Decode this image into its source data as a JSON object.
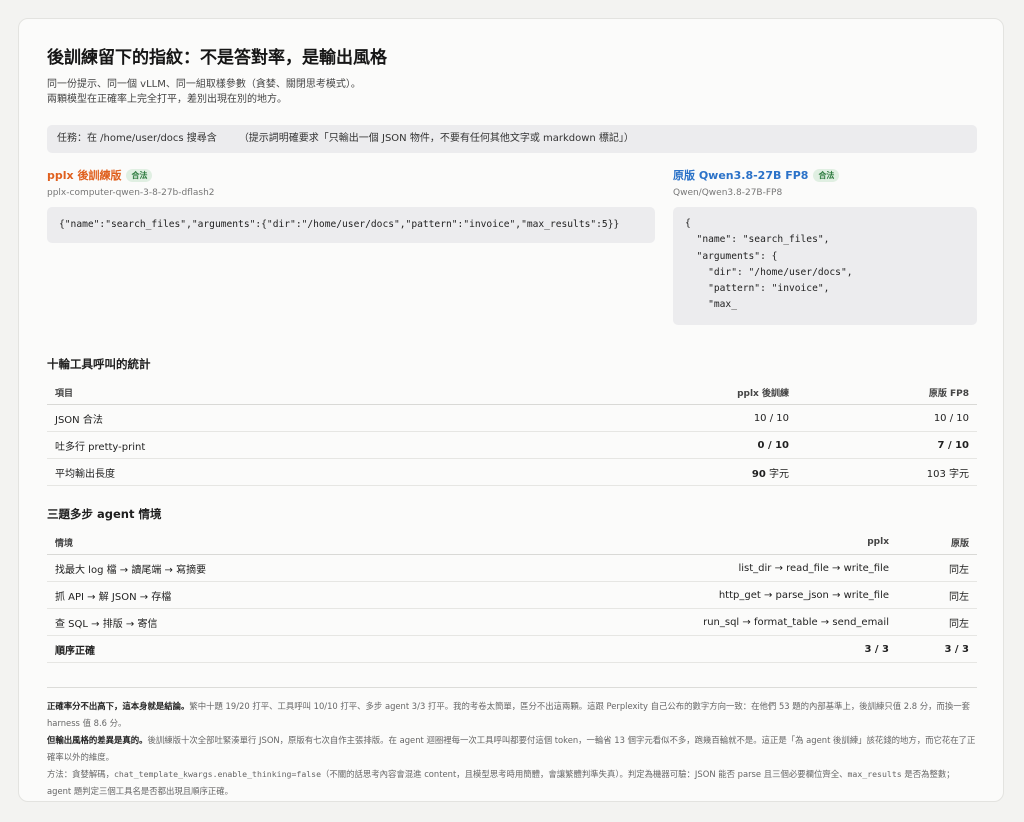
{
  "header": {
    "title": "後訓練留下的指紋：不是答對率，是輸出風格",
    "subtitle_1": "同一份提示、同一個 vLLM、同一組取樣參數（貪婪、關閉思考模式）。",
    "subtitle_2": "兩顆模型在正確率上完全打平，差別出現在別的地方。"
  },
  "task": {
    "label": "任務：在 /home/user/docs 搜尋含",
    "hint": "（提示詞明確要求「只輸出一個 JSON 物件，不要有任何其他文字或 markdown 標記」）"
  },
  "models": {
    "left": {
      "name": "pplx 後訓練版",
      "badge": "合法",
      "id": "pplx-computer-qwen-3-8-27b-dflash2",
      "code": "{\"name\":\"search_files\",\"arguments\":{\"dir\":\"/home/user/docs\",\"pattern\":\"invoice\",\"max_results\":5}}"
    },
    "right": {
      "name": "原版 Qwen3.8-27B FP8",
      "badge": "合法",
      "id": "Qwen/Qwen3.8-27B-FP8",
      "code": "{\n  \"name\": \"search_files\",\n  \"arguments\": {\n    \"dir\": \"/home/user/docs\",\n    \"pattern\": \"invoice\",\n    \"max_"
    }
  },
  "stats": {
    "title": "十輪工具呼叫的統計",
    "headers": [
      "項目",
      "pplx 後訓練",
      "原版 FP8"
    ],
    "rows": [
      {
        "item": "JSON 合法",
        "pplx": "10 / 10",
        "orig": "10 / 10"
      },
      {
        "item": "吐多行 pretty-print",
        "pplx": "0 / 10",
        "orig": "7 / 10"
      },
      {
        "item": "平均輸出長度",
        "pplx_num": "90",
        "pplx_unit": " 字元",
        "orig": "103 字元"
      }
    ]
  },
  "agent": {
    "title": "三題多步 agent 情境",
    "headers": [
      "情境",
      "pplx",
      "原版"
    ],
    "rows": [
      {
        "scenario": "找最大 log 檔 → 讀尾端 → 寫摘要",
        "pplx": "list_dir → read_file → write_file",
        "orig": "同左"
      },
      {
        "scenario": "抓 API → 解 JSON → 存檔",
        "pplx": "http_get → parse_json → write_file",
        "orig": "同左"
      },
      {
        "scenario": "查 SQL → 排版 → 寄信",
        "pplx": "run_sql → format_table → send_email",
        "orig": "同左"
      }
    ],
    "total": {
      "label": "順序正確",
      "pplx": "3 / 3",
      "orig": "3 / 3"
    }
  },
  "footer": {
    "p1_strong": "正確率分不出高下，這本身就是結論。",
    "p1": "繁中十題 19/20 打平、工具呼叫 10/10 打平、多步 agent 3/3 打平。我的考卷太簡單，區分不出這兩顆。這跟 Perplexity 自己公布的數字方向一致：在他們 53 題的內部基準上，後訓練只值 2.8 分，而換一套 harness 值 8.6 分。",
    "p2_strong": "但輸出風格的差異是真的。",
    "p2": "後訓練版十次全部吐緊湊單行 JSON，原版有七次自作主張排版。在 agent 迴圈裡每一次工具呼叫都要付這個 token，一輪省 13 個字元看似不多，跑幾百輪就不是。這正是「為 agent 後訓練」該花錢的地方，而它花在了正確率以外的維度。",
    "p3_a": "方法：貪婪解碼，",
    "p3_code1": "chat_template_kwargs.enable_thinking=false",
    "p3_b": "（不關的話思考內容會混進 content，且模型思考時用簡體，會讓繁體判準失真）。判定為機器可驗：JSON 能否 parse 且三個必要欄位齊全、",
    "p3_code2": "max_results",
    "p3_c": " 是否為整數；agent 題判定三個工具名是否都出現且順序正確。"
  }
}
